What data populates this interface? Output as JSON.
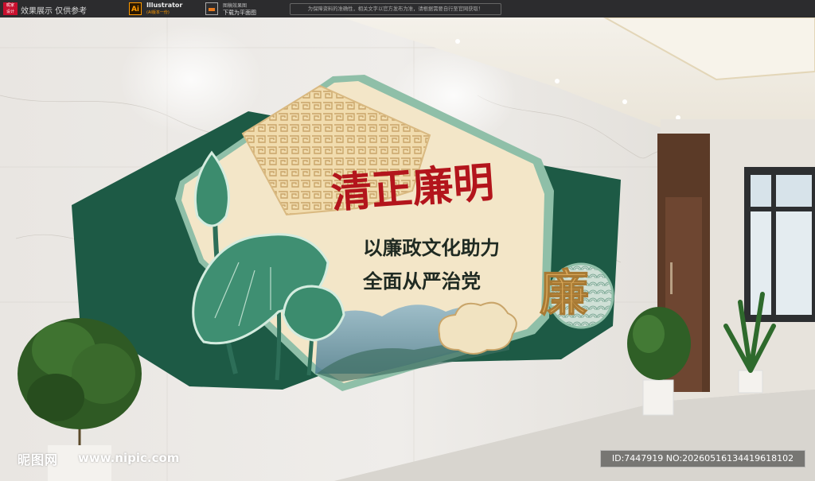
{
  "topbar": {
    "badge": "昵家\n设计",
    "notice_text": "效果展示 仅供参考",
    "ai_label": "Ai",
    "ai_app": "Illustrator",
    "ai_sub": "(AI版本一份)",
    "download_small": "图稿效果图",
    "download_label": "下载为平面图",
    "disclaimer": "为保障资料的准确性，相关文字以官方发布为准，请根据需要自行至官网获取！"
  },
  "sign": {
    "title": "清正廉明",
    "slogan_line1": "以廉政文化助力",
    "slogan_line2": "全面从严治党",
    "side_char": "廉"
  },
  "watermark": {
    "logo": "昵图网",
    "url": "www.nipic.com",
    "id_text": "ID:7447919 NO:20260516134419618102"
  },
  "colors": {
    "dark_green": "#1f5a46",
    "light_green": "#8fbfa8",
    "cream": "#f3e6c8",
    "red_title": "#b3151c",
    "gold": "#d9a85a"
  }
}
